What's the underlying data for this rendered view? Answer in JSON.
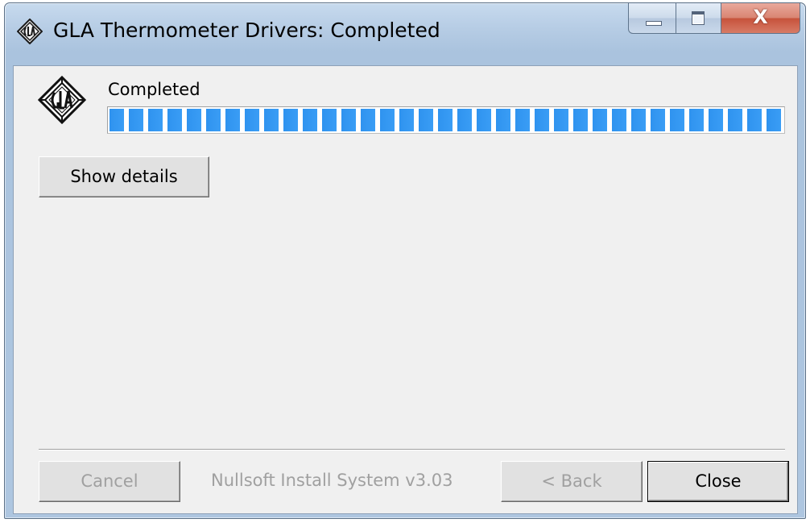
{
  "window": {
    "title": "GLA Thermometer Drivers: Completed",
    "icon": "gla-logo-icon",
    "caption_buttons": {
      "minimize_icon": "minimize-icon",
      "maximize_icon": "maximize-icon",
      "close_icon": "close-icon",
      "close_glyph": "X"
    }
  },
  "main": {
    "app_icon": "gla-logo-icon",
    "status_label": "Completed",
    "progress": {
      "value_percent": 100,
      "color": "#3296f0"
    },
    "show_details_label": "Show details"
  },
  "footer": {
    "cancel_label": "Cancel",
    "branding": "Nullsoft Install System v3.03",
    "back_label": "< Back",
    "close_label": "Close"
  },
  "colors": {
    "dialog_background": "#f0f0f0",
    "progress_fill": "#3296f0",
    "disabled_text": "#a0a0a0"
  }
}
